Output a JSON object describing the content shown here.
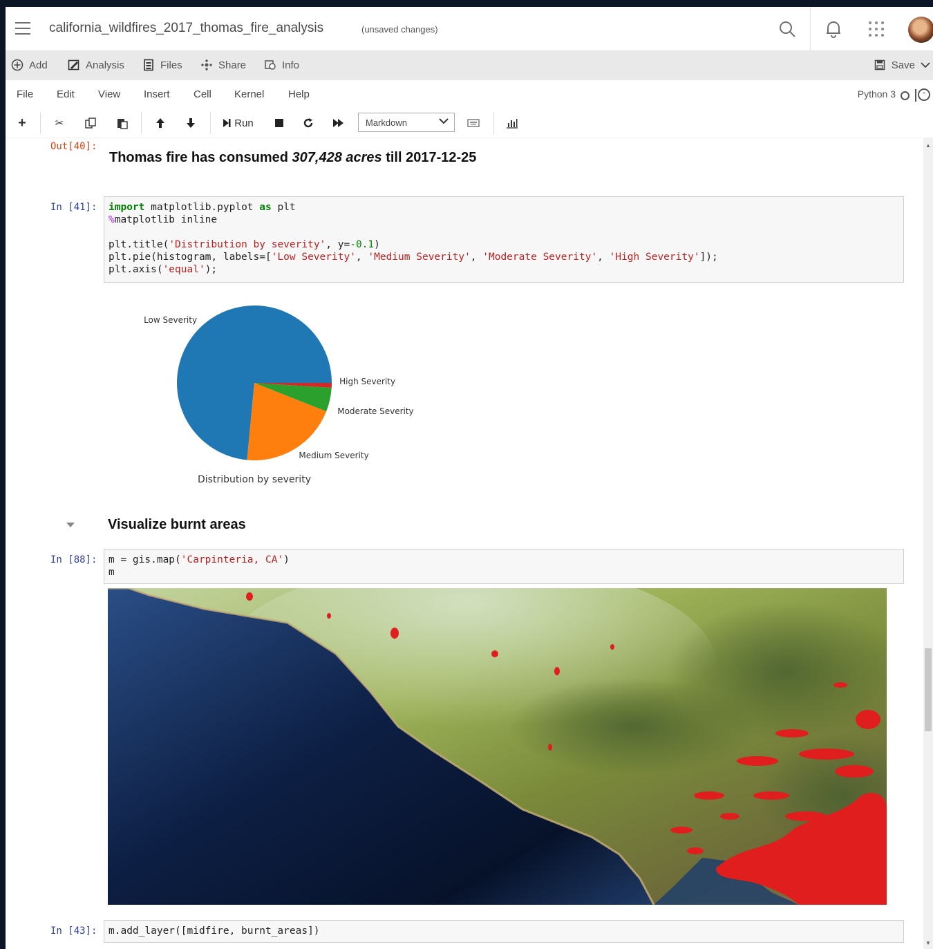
{
  "header": {
    "notebook_title": "california_wildfires_2017_thomas_fire_analysis",
    "unsaved": "(unsaved changes)"
  },
  "arcgis_menu": {
    "items": [
      {
        "label": "Add",
        "icon": "plus-circle-icon"
      },
      {
        "label": "Analysis",
        "icon": "analysis-icon"
      },
      {
        "label": "Files",
        "icon": "files-icon"
      },
      {
        "label": "Share",
        "icon": "share-icon"
      },
      {
        "label": "Info",
        "icon": "info-icon"
      }
    ],
    "save_label": "Save"
  },
  "menubar": {
    "items": [
      "File",
      "Edit",
      "View",
      "Insert",
      "Cell",
      "Kernel",
      "Help"
    ],
    "kernel": "Python 3"
  },
  "toolbar": {
    "run_label": "Run",
    "cell_type": "Markdown"
  },
  "cells": {
    "out40": {
      "prompt": "Out[40]:",
      "text_pre": "Thomas fire has consumed ",
      "text_em": "307,428 acres",
      "text_post": " till 2017-12-25"
    },
    "in41": {
      "prompt": "In [41]:",
      "lines": [
        "import matplotlib.pyplot as plt",
        "%matplotlib inline",
        "",
        "plt.title('Distribution by severity', y=-0.1)",
        "plt.pie(histogram, labels=['Low Severity', 'Medium Severity', 'Moderate Severity', 'High Severity']);",
        "plt.axis('equal');"
      ]
    },
    "heading": "Visualize burnt areas",
    "in88": {
      "prompt": "In [88]:",
      "lines": [
        "m = gis.map('Carpinteria, CA')",
        "m"
      ]
    },
    "in43": {
      "prompt": "In [43]:",
      "lines": [
        "m.add_layer([midfire, burnt_areas])"
      ]
    }
  },
  "chart_data": {
    "type": "pie",
    "title": "Distribution by severity",
    "categories": [
      "Low Severity",
      "Medium Severity",
      "Moderate Severity",
      "High Severity"
    ],
    "values": [
      73.5,
      20.5,
      5.0,
      1.0
    ],
    "colors": [
      "#1f77b4",
      "#ff7f0e",
      "#2ca02c",
      "#d62728"
    ],
    "start_angle_deg": 0,
    "direction": "counterclockwise"
  }
}
